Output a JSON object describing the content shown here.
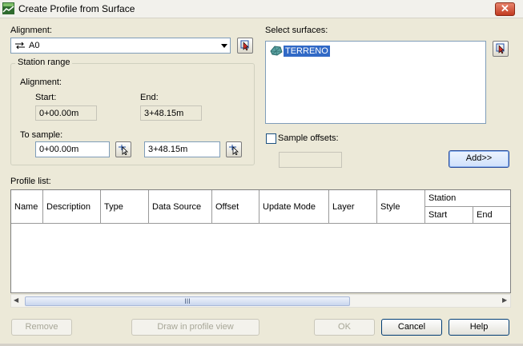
{
  "window": {
    "title": "Create Profile from Surface",
    "close_label": "✕"
  },
  "alignment": {
    "label": "Alignment:",
    "selected": "A0"
  },
  "station_range": {
    "group_title": "Station range",
    "alignment_label": "Alignment:",
    "start_label": "Start:",
    "end_label": "End:",
    "start_value": "0+00.00m",
    "end_value": "3+48.15m",
    "to_sample_label": "To sample:",
    "sample_start": "0+00.00m",
    "sample_end": "3+48.15m"
  },
  "surfaces": {
    "label": "Select surfaces:",
    "items": [
      "TERRENO"
    ]
  },
  "sample_offsets": {
    "label": "Sample offsets:",
    "checked": false,
    "value": ""
  },
  "buttons": {
    "add": "Add>>",
    "remove": "Remove",
    "draw": "Draw in profile view",
    "ok": "OK",
    "cancel": "Cancel",
    "help": "Help"
  },
  "profile_list": {
    "label": "Profile list:",
    "columns": [
      "Name",
      "Description",
      "Type",
      "Data Source",
      "Offset",
      "Update Mode",
      "Layer",
      "Style"
    ],
    "station_group": "Station",
    "station_columns": [
      "Start",
      "End"
    ],
    "rows": []
  },
  "scrollbar": {
    "grip": "III"
  }
}
